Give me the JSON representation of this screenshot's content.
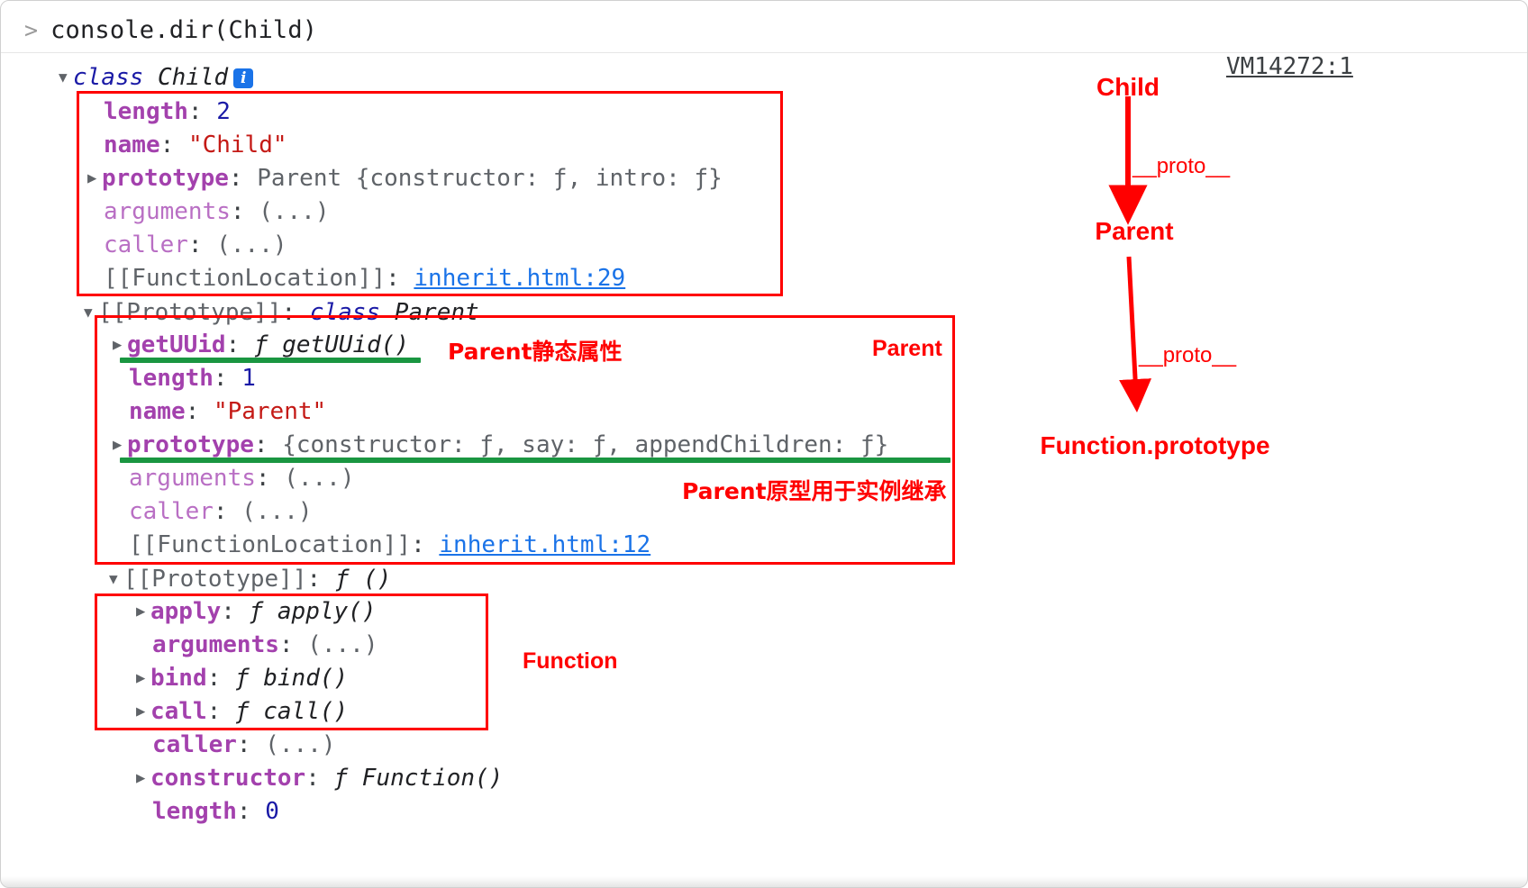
{
  "console": {
    "prompt_symbol": ">",
    "command": "console.dir(Child)",
    "source_link": "VM14272:1"
  },
  "tree": {
    "root": {
      "toggle": "▼",
      "keyword": "class",
      "name": "Child",
      "info_badge": "i"
    },
    "child_props": [
      {
        "toggle": "",
        "key": "length",
        "sep": ": ",
        "value": "2",
        "value_kind": "number"
      },
      {
        "toggle": "",
        "key": "name",
        "sep": ": ",
        "value": "\"Child\"",
        "value_kind": "string"
      },
      {
        "toggle": "▶",
        "key": "prototype",
        "sep": ": ",
        "value": "Parent {constructor: ƒ, intro: ƒ}",
        "value_kind": "object"
      },
      {
        "toggle": "",
        "key": "arguments",
        "sep": ": ",
        "value": "(...)",
        "value_kind": "faded"
      },
      {
        "toggle": "",
        "key": "caller",
        "sep": ": ",
        "value": "(...)",
        "value_kind": "faded"
      },
      {
        "toggle": "",
        "key": "[[FunctionLocation]]",
        "sep": ": ",
        "value": "inherit.html:29",
        "value_kind": "link"
      }
    ],
    "parent_proto_header": {
      "toggle": "▼",
      "key": "[[Prototype]]",
      "sep": ": ",
      "keyword": "class",
      "name": "Parent"
    },
    "parent_props": [
      {
        "toggle": "▶",
        "key": "getUUid",
        "sep": ": ",
        "value": "ƒ getUUid()",
        "value_kind": "function"
      },
      {
        "toggle": "",
        "key": "length",
        "sep": ": ",
        "value": "1",
        "value_kind": "number"
      },
      {
        "toggle": "",
        "key": "name",
        "sep": ": ",
        "value": "\"Parent\"",
        "value_kind": "string"
      },
      {
        "toggle": "▶",
        "key": "prototype",
        "sep": ": ",
        "value": "{constructor: ƒ, say: ƒ, appendChildren: ƒ}",
        "value_kind": "object"
      },
      {
        "toggle": "",
        "key": "arguments",
        "sep": ": ",
        "value": "(...)",
        "value_kind": "faded"
      },
      {
        "toggle": "",
        "key": "caller",
        "sep": ": ",
        "value": "(...)",
        "value_kind": "faded"
      },
      {
        "toggle": "",
        "key": "[[FunctionLocation]]",
        "sep": ": ",
        "value": "inherit.html:12",
        "value_kind": "link"
      }
    ],
    "function_proto_header": {
      "toggle": "▼",
      "key": "[[Prototype]]",
      "sep": ": ",
      "value": "ƒ ()"
    },
    "function_props": [
      {
        "toggle": "▶",
        "key": "apply",
        "sep": ": ",
        "value": "ƒ apply()",
        "value_kind": "function"
      },
      {
        "toggle": "",
        "key": "arguments",
        "sep": ": ",
        "value": "(...)",
        "value_kind": "faded"
      },
      {
        "toggle": "▶",
        "key": "bind",
        "sep": ": ",
        "value": "ƒ bind()",
        "value_kind": "function"
      },
      {
        "toggle": "▶",
        "key": "call",
        "sep": ": ",
        "value": "ƒ call()",
        "value_kind": "function"
      },
      {
        "toggle": "",
        "key": "caller",
        "sep": ": ",
        "value": "(...)",
        "value_kind": "faded"
      },
      {
        "toggle": "▶",
        "key": "constructor",
        "sep": ": ",
        "value": "ƒ Function()",
        "value_kind": "function"
      },
      {
        "toggle": "",
        "key": "length",
        "sep": ": ",
        "value": "0",
        "value_kind": "number"
      }
    ]
  },
  "annotations": {
    "child_box_label": "",
    "parent_label": "Parent",
    "function_label": "Function",
    "static_props_note": "Parent静态属性",
    "prototype_note": "Parent原型用于实例继承"
  },
  "diagram": {
    "nodes": [
      "Child",
      "Parent",
      "Function.prototype"
    ],
    "edges": [
      "__proto__",
      "__proto__"
    ]
  },
  "colors": {
    "annotation_red": "#ff0000",
    "underline_green": "#1a9641",
    "property_purple": "#a341ad",
    "string_red": "#c41a16",
    "number_blue": "#1a1aa6",
    "link_blue": "#1a73e8"
  }
}
